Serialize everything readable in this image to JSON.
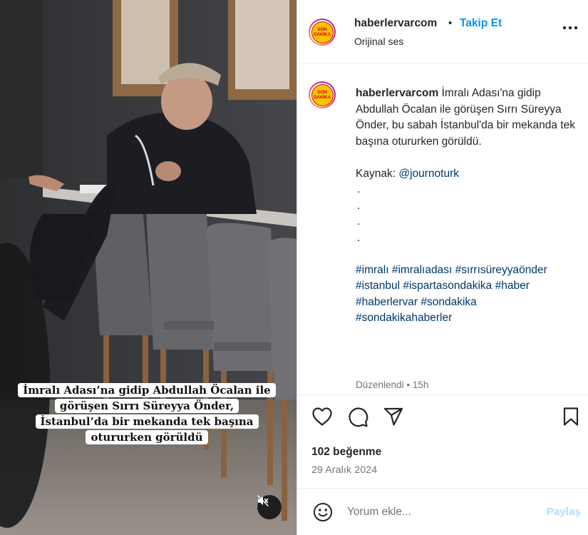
{
  "media": {
    "caption_lines": [
      "İmralı Adası’na gidip Abdullah Öcalan ile",
      "görüşen Sırrı Süreyya Önder,",
      "İstanbul’da bir mekanda tek başına",
      "otururken görüldü"
    ],
    "mute_icon": "speaker-muted-icon"
  },
  "header": {
    "avatar_text_top": "SON",
    "avatar_text_bottom": "DAKİKA",
    "username": "haberlervarcom",
    "separator": "•",
    "follow_label": "Takip Et",
    "audio_label": "Orijinal ses",
    "more_icon": "more-options-icon"
  },
  "post": {
    "username": "haberlervarcom",
    "text": "İmralı Adası'na gidip Abdullah Öcalan ile görüşen Sırrı Süreyya Önder, bu sabah İstanbul'da bir mekanda tek başına otururken görüldü.",
    "source_label": "Kaynak:",
    "source_handle": "@journoturk",
    "dots": [
      ".",
      ".",
      ".",
      "."
    ],
    "hashtags": [
      "#imralı",
      "#imralıadası",
      "#sırrısüreyyaönder",
      "#istanbul",
      "#ispartasondakika",
      "#haber",
      "#haberlervar",
      "#sondakika",
      "#sondakikahaberler"
    ],
    "edited_label": "Düzenlendi",
    "edited_separator": "•",
    "edited_time": "15h"
  },
  "actions": {
    "icons": [
      "heart-icon",
      "comment-icon",
      "share-icon",
      "bookmark-icon"
    ],
    "likes": "102 beğenme",
    "date": "29 Aralık 2024"
  },
  "comment": {
    "placeholder": "Yorum ekle...",
    "share_label": "Paylaş"
  },
  "colors": {
    "link_blue": "#0095f6",
    "hashtag_blue": "#00376b",
    "muted_text": "#737373",
    "share_disabled": "#b3dbff"
  }
}
